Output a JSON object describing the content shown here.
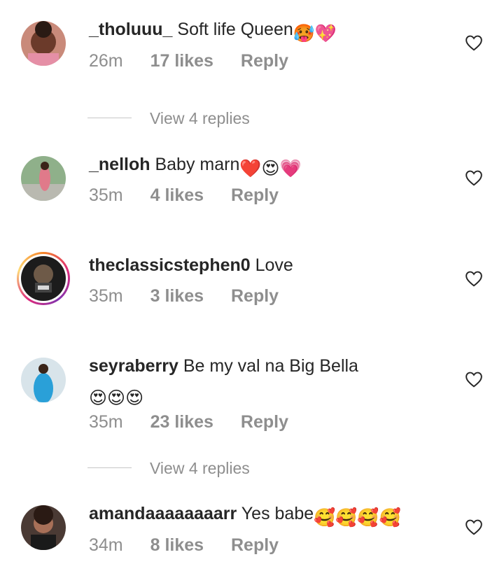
{
  "comments": [
    {
      "username": "_tholuuu_",
      "text": "Soft life Queen",
      "emoji": "🥵💖",
      "time": "26m",
      "likes": "17 likes",
      "reply": "Reply"
    },
    {
      "username": "_nelloh",
      "text": "Baby marn",
      "emoji": "❤️😍💗",
      "time": "35m",
      "likes": "4 likes",
      "reply": "Reply"
    },
    {
      "username": "theclassicstephen0",
      "text": "Love",
      "emoji": "",
      "time": "35m",
      "likes": "3 likes",
      "reply": "Reply"
    },
    {
      "username": "seyraberry",
      "text": "Be my val na Big Bella",
      "emoji": "😍😍😍",
      "time": "35m",
      "likes": "23 likes",
      "reply": "Reply"
    },
    {
      "username": "amandaaaaaaaarr",
      "text": "Yes babe",
      "emoji": "🥰🥰🥰🥰",
      "time": "34m",
      "likes": "8 likes",
      "reply": "Reply"
    }
  ],
  "view_replies": [
    "View 4 replies",
    "View 4 replies"
  ],
  "icons": {
    "like": "heart-outline-icon"
  }
}
